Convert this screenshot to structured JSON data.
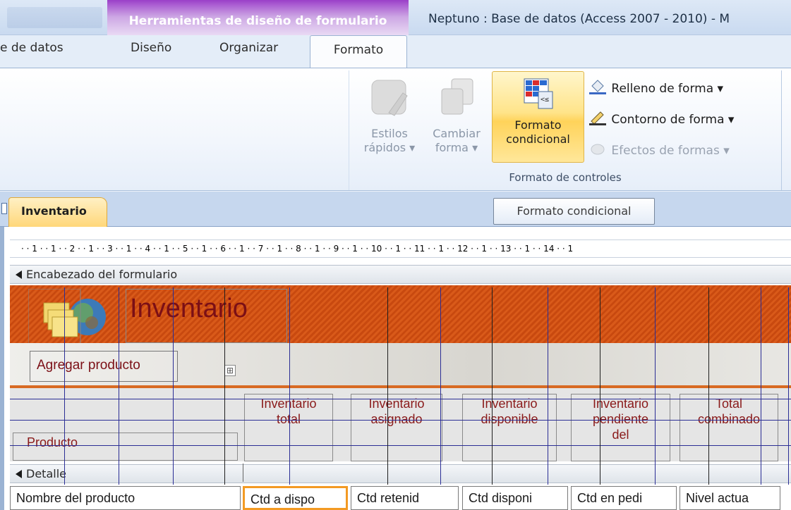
{
  "titlebar": {
    "context_group": "Herramientas de diseño de formulario",
    "window_title": "Neptuno : Base de datos (Access 2007 - 2010)  -  M"
  },
  "tabs": [
    {
      "label": "e de datos"
    },
    {
      "label": "Diseño"
    },
    {
      "label": "Organizar"
    },
    {
      "label": "Formato",
      "active": true
    }
  ],
  "ribbon": {
    "estilos": {
      "line1": "Estilos",
      "line2": "rápidos ▾",
      "enabled": false
    },
    "cambiar": {
      "line1": "Cambiar",
      "line2": "forma ▾",
      "enabled": false
    },
    "formato": {
      "line1": "Formato",
      "line2": "condicional",
      "state": "hover"
    },
    "relleno": "Relleno de forma ▾",
    "contorno": "Contorno de forma ▾",
    "efectos": "Efectos de formas ▾",
    "group_label": "Formato de controles"
  },
  "document": {
    "tab": "Inventario",
    "tooltip": "Formato condicional"
  },
  "ruler": {
    "ticks": [
      "· · 1 · · 1 · · 2 · · 1 · · 3 · · 1 · · 4 · · 1 · · 5 · · 1 · · 6 · · 1 · · 7 · · 1 · · 8 · · 1 · · 9 · · 1 · · 10 · · 1 · · 11 · · 1 · · 12 · · 1 · · 13 · · 1 · · 14 · · 1"
    ]
  },
  "form": {
    "header_section": "Encabezado del formulario",
    "title": "Inventario",
    "add_product": "Agregar producto",
    "move_handle": "⊞",
    "producto_label": "Producto",
    "columns": [
      {
        "l1": "Inventario",
        "l2": "total",
        "l3": ""
      },
      {
        "l1": "Inventario",
        "l2": "asignado",
        "l3": ""
      },
      {
        "l1": "Inventario",
        "l2": "disponible",
        "l3": ""
      },
      {
        "l1": "Inventario",
        "l2": "pendiente",
        "l3": "del"
      },
      {
        "l1": "Total",
        "l2": "combinado",
        "l3": ""
      }
    ],
    "detail_section": "Detalle",
    "fields": [
      "Nombre del producto",
      "Ctd a dispo",
      "Ctd retenid",
      "Ctd disponi",
      "Ctd en pedi",
      "Nivel actua"
    ]
  },
  "colors": {
    "accent_orange": "#d95a1a",
    "label_red": "#7b0f16",
    "context_purple": "#a95ad1",
    "grid_blue": "#2b2e95"
  }
}
